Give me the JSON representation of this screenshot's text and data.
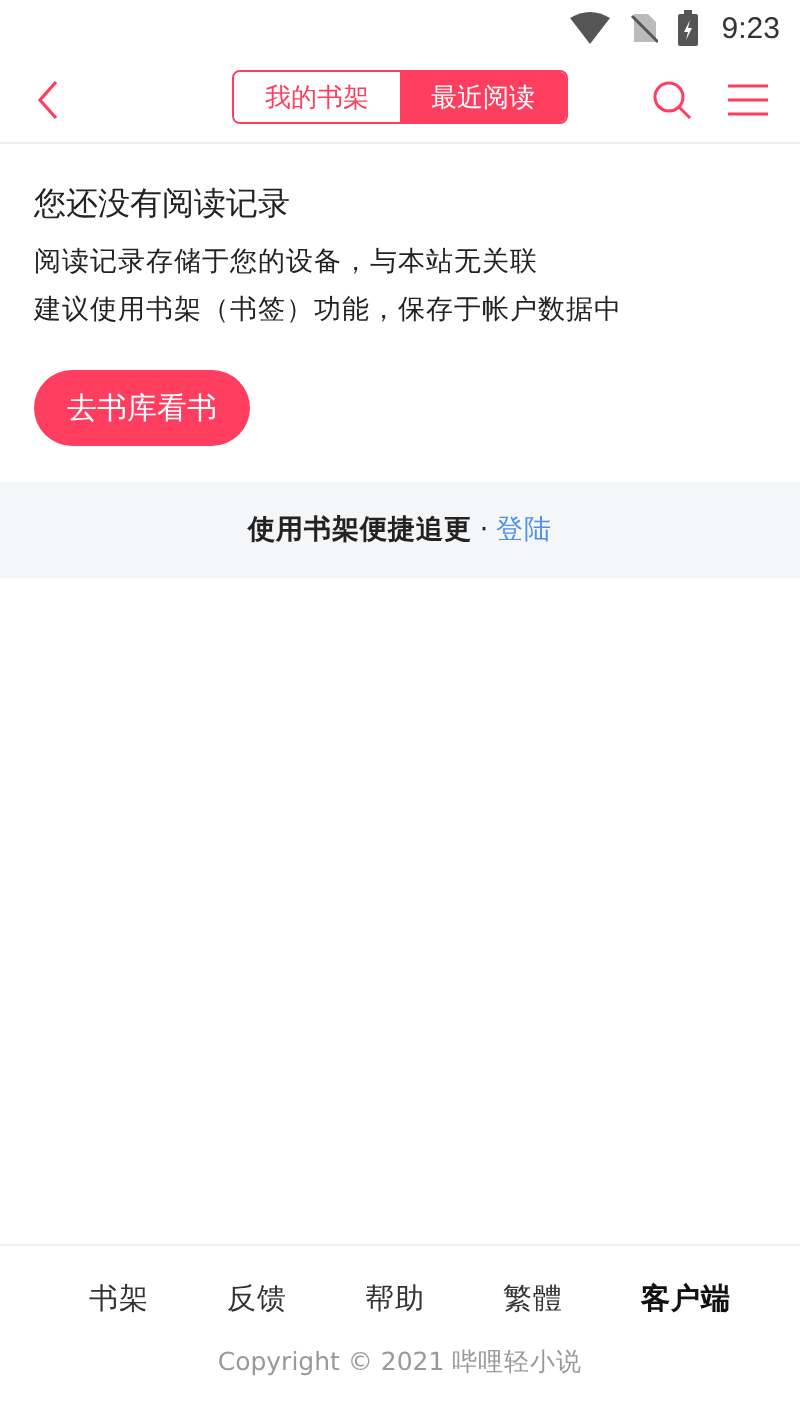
{
  "status_bar": {
    "time": "9:23"
  },
  "header": {
    "tabs": [
      {
        "label": "我的书架",
        "selected": false
      },
      {
        "label": "最近阅读",
        "selected": true
      }
    ]
  },
  "empty_state": {
    "title": "您还没有阅读记录",
    "lines": [
      "阅读记录存储于您的设备，与本站无关联",
      "建议使用书架（书签）功能，保存于帐户数据中"
    ],
    "button": "去书库看书"
  },
  "login_banner": {
    "text": "使用书架便捷追更",
    "separator": "·",
    "link": "登陆"
  },
  "footer": {
    "links": [
      {
        "label": "书架",
        "bold": false
      },
      {
        "label": "反馈",
        "bold": false
      },
      {
        "label": "帮助",
        "bold": false
      },
      {
        "label": "繁體",
        "bold": false
      },
      {
        "label": "客户端",
        "bold": true
      }
    ],
    "copyright": "Copyright © 2021 哔哩轻小说"
  }
}
